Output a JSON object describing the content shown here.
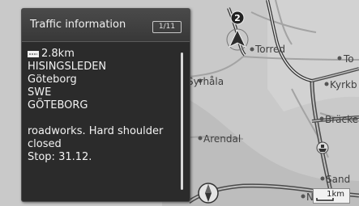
{
  "panel": {
    "title": "Traffic information",
    "page_counter": "1/11",
    "distance": "2.8km",
    "road": "HISINGSLEDEN",
    "city": "Göteborg",
    "country": "SWE",
    "region": "GÖTEBORG",
    "message_line1": "roadworks. Hard shoulder",
    "message_line2": "closed",
    "stop": "Stop: 31.12."
  },
  "map": {
    "places": {
      "torred": "Torred",
      "syrhala": "Syrhåla",
      "arendal": "Arendal",
      "to": "To",
      "kyrkb": "Kyrkb",
      "bracke": "Bräcke",
      "sand": "Sand",
      "n": "N"
    },
    "route_marker_number": "2",
    "scale": "1km"
  },
  "colors": {
    "map_background": "#c9c9c9",
    "panel_background": "#2b2b2b",
    "panel_text": "#f2f2f2"
  }
}
